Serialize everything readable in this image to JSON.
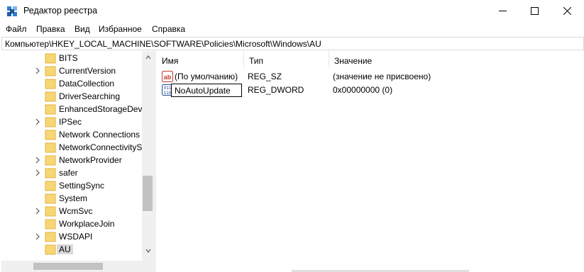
{
  "window": {
    "title": "Редактор реестра",
    "icon": "regedit-icon"
  },
  "menu": [
    "Файл",
    "Правка",
    "Вид",
    "Избранное",
    "Справка"
  ],
  "address": "Компьютер\\HKEY_LOCAL_MACHINE\\SOFTWARE\\Policies\\Microsoft\\Windows\\AU",
  "tree": {
    "items": [
      {
        "label": "BITS",
        "expandable": false
      },
      {
        "label": "CurrentVersion",
        "expandable": true
      },
      {
        "label": "DataCollection",
        "expandable": false
      },
      {
        "label": "DriverSearching",
        "expandable": false
      },
      {
        "label": "EnhancedStorageDevi",
        "expandable": false
      },
      {
        "label": "IPSec",
        "expandable": true
      },
      {
        "label": "Network Connections",
        "expandable": false
      },
      {
        "label": "NetworkConnectivityS",
        "expandable": false
      },
      {
        "label": "NetworkProvider",
        "expandable": true
      },
      {
        "label": "safer",
        "expandable": true
      },
      {
        "label": "SettingSync",
        "expandable": false
      },
      {
        "label": "System",
        "expandable": false
      },
      {
        "label": "WcmSvc",
        "expandable": true
      },
      {
        "label": "WorkplaceJoin",
        "expandable": false
      },
      {
        "label": "WSDAPI",
        "expandable": true
      },
      {
        "label": "AU",
        "expandable": false,
        "selected": true
      }
    ]
  },
  "list": {
    "columns": {
      "name": "Имя",
      "type": "Тип",
      "value": "Значение"
    },
    "rows": [
      {
        "icon": "string-value-icon",
        "name": "(По умолчанию)",
        "type": "REG_SZ",
        "value": "(значение не присвоено)"
      },
      {
        "icon": "dword-value-icon",
        "name": "NoAutoUpdate",
        "type": "REG_DWORD",
        "value": "0x00000000 (0)",
        "editing": true
      }
    ]
  },
  "colors": {
    "folder": "#f7d774",
    "folder_dark": "#e3b341",
    "selection": "#d9d9d9",
    "string_icon": "#c0392b",
    "dword_icon": "#1f4e9c"
  }
}
